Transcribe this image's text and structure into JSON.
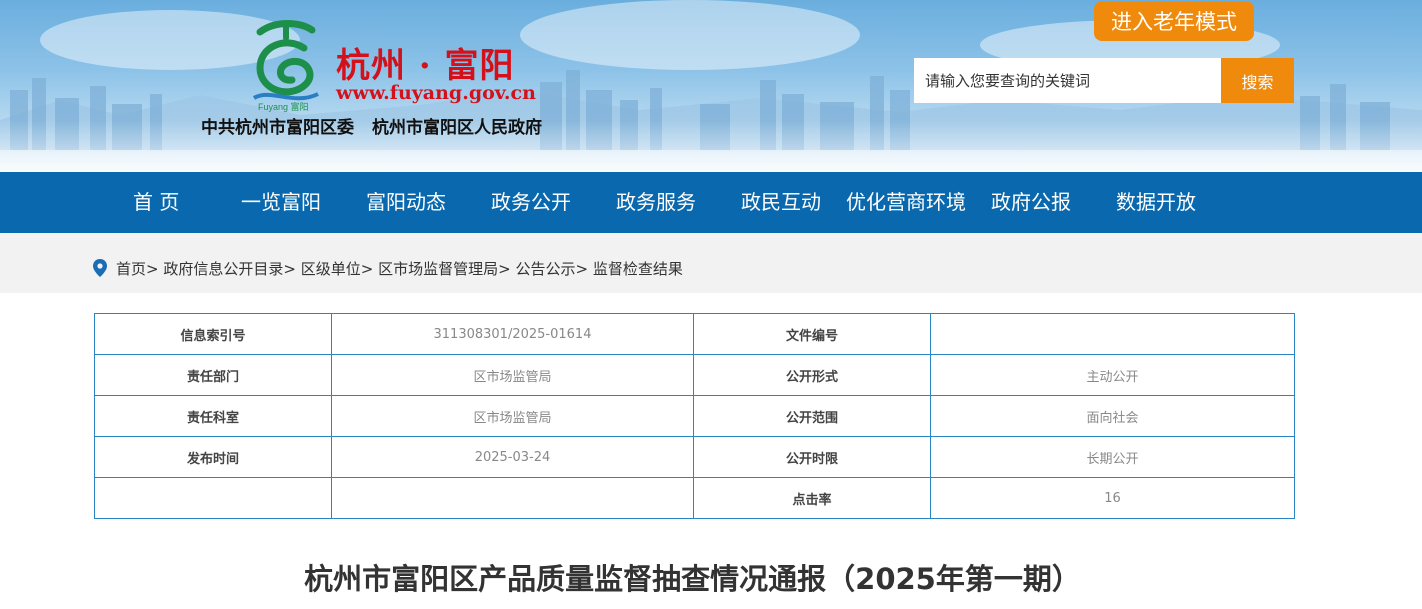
{
  "header": {
    "site_name": "杭州 · 富阳",
    "site_url": "www.fuyang.gov.cn",
    "org_party": "中共杭州市富阳区委",
    "org_gov": "杭州市富阳区人民政府",
    "logo_text": "Fuyang 富阳",
    "elder_mode_label": "进入老年模式",
    "search_placeholder": "请输入您要查询的关键词",
    "search_button_label": "搜索"
  },
  "nav": {
    "items": [
      "首 页",
      "一览富阳",
      "富阳动态",
      "政务公开",
      "政务服务",
      "政民互动",
      "优化营商环境",
      "政府公报",
      "数据开放"
    ]
  },
  "breadcrumb": {
    "items": [
      "首页",
      "政府信息公开目录",
      "区级单位",
      "区市场监督管理局",
      "公告公示",
      "监督检查结果"
    ],
    "separator": ">"
  },
  "info": {
    "rows": [
      [
        "信息索引号",
        "311308301/2025-01614",
        "文件编号",
        ""
      ],
      [
        "责任部门",
        "区市场监管局",
        "公开形式",
        "主动公开"
      ],
      [
        "责任科室",
        "区市场监管局",
        "公开范围",
        "面向社会"
      ],
      [
        "发布时间",
        "2025-03-24",
        "公开时限",
        "长期公开"
      ],
      [
        "",
        "",
        "点击率",
        "16"
      ]
    ]
  },
  "article": {
    "title": "杭州市富阳区产品质量监督抽查情况通报（2025年第一期）"
  },
  "colors": {
    "nav_blue": "#0a69ae",
    "accent_orange": "#f08a0c",
    "brand_red": "#d4111b",
    "table_border": "#2a85c4"
  },
  "icons": [
    "location-pin-icon",
    "fuyang-logo"
  ]
}
